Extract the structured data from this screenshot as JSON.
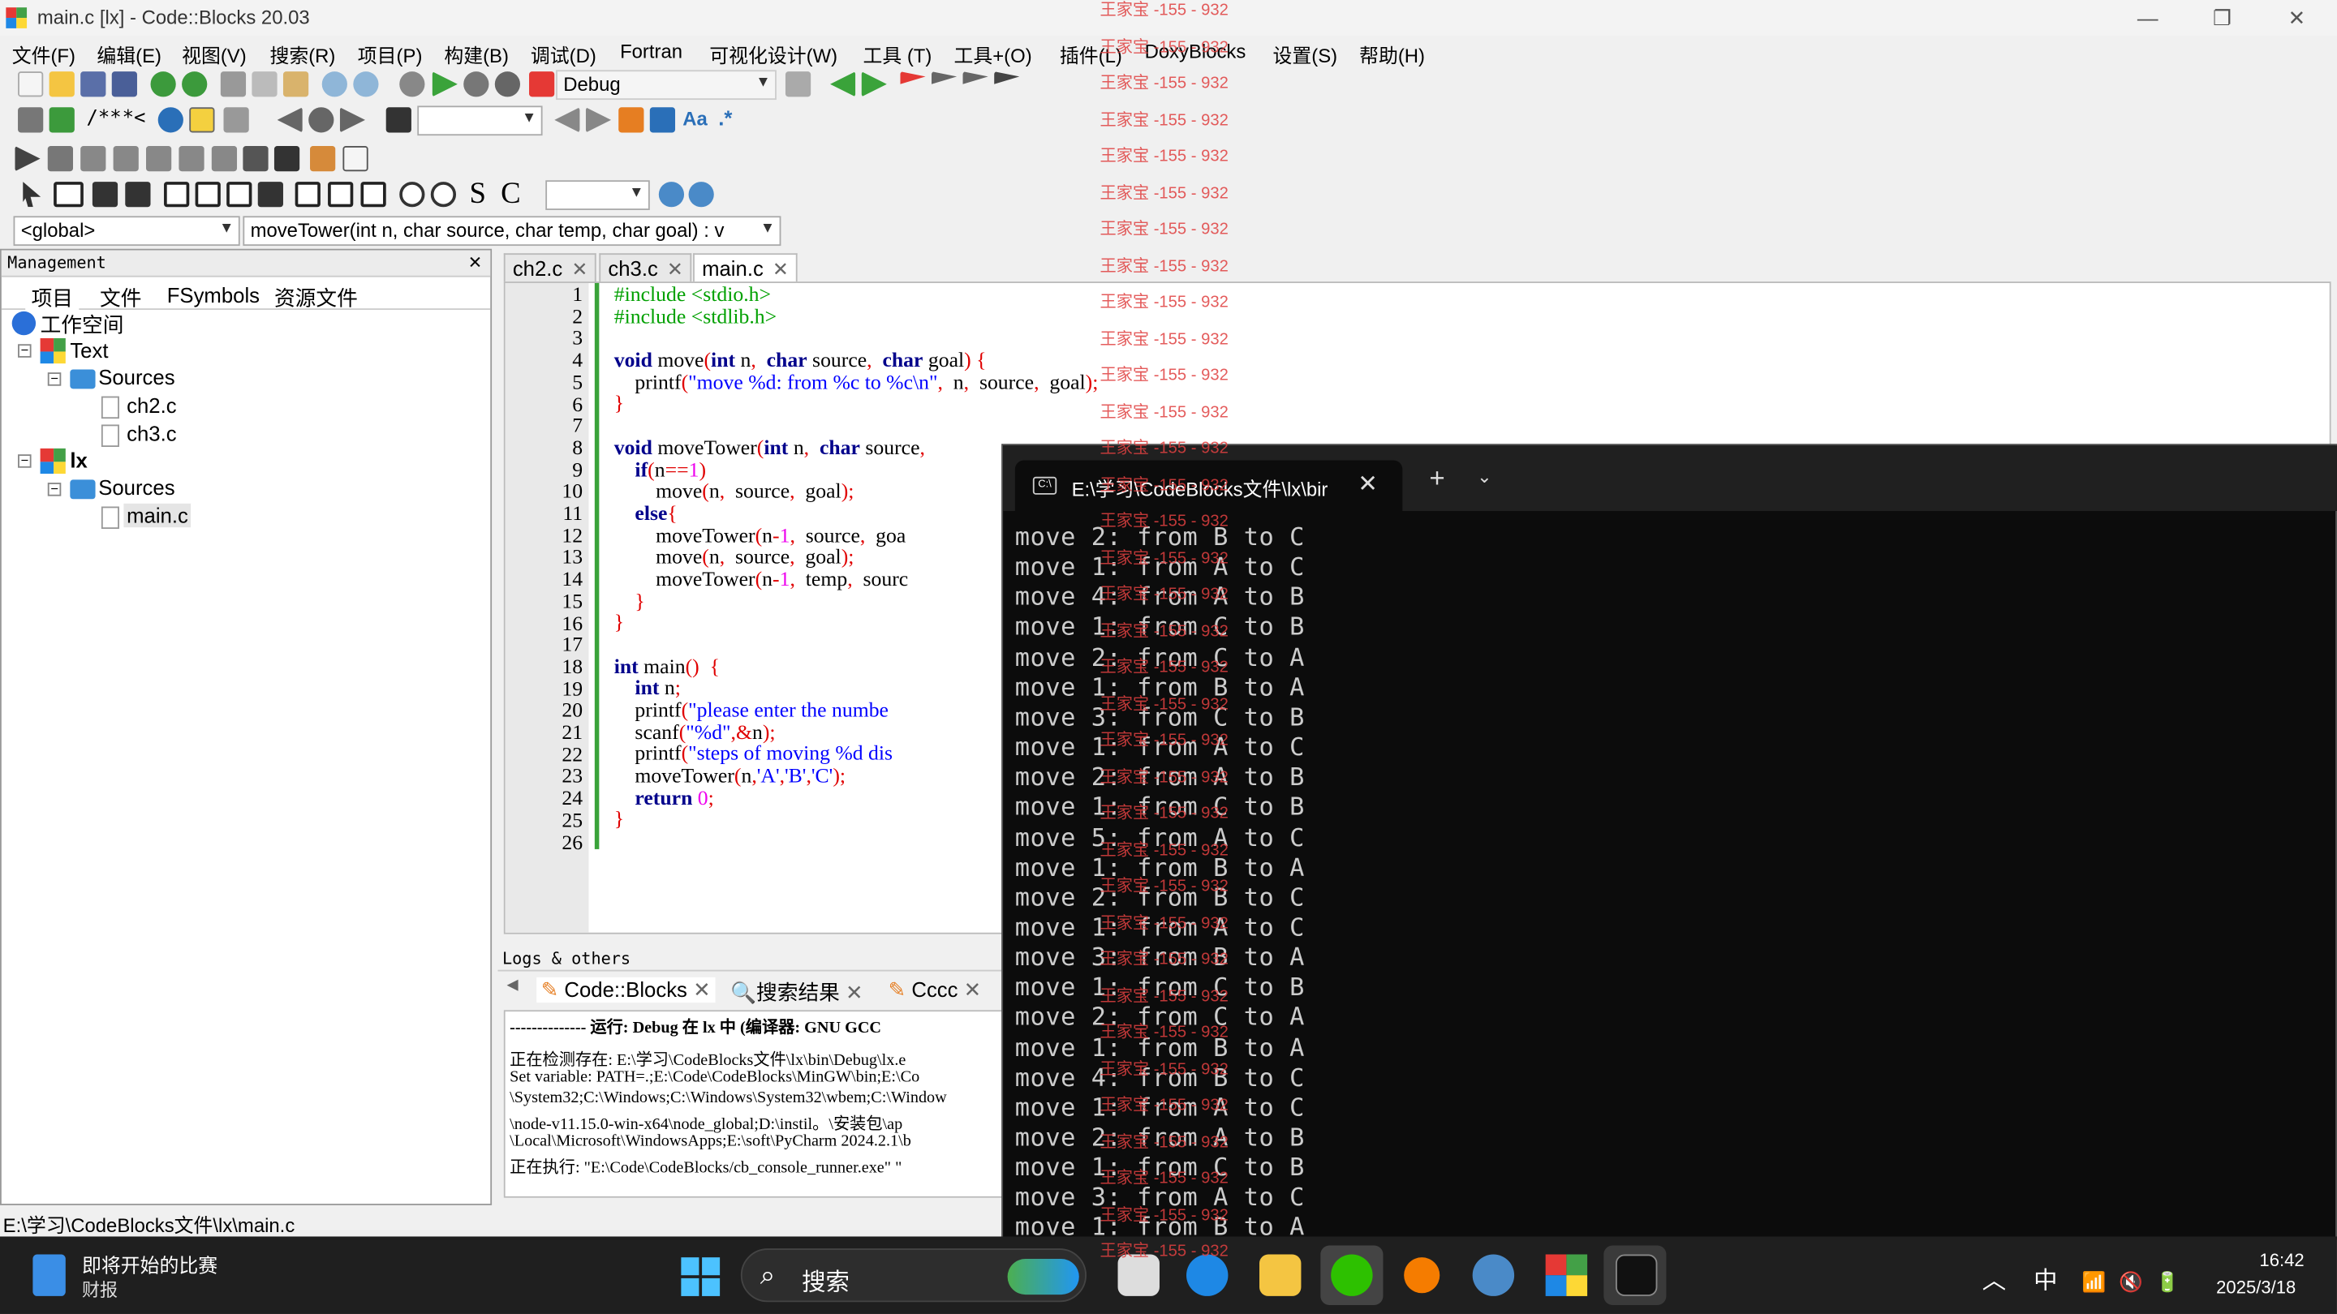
{
  "window": {
    "title": "main.c [lx] - Code::Blocks 20.03",
    "minimize": "—",
    "maximize": "❐",
    "close": "✕"
  },
  "menu": [
    "文件(F)",
    "编辑(E)",
    "视图(V)",
    "搜索(R)",
    "项目(P)",
    "构建(B)",
    "调试(D)",
    "Fortran",
    "可视化设计(W)",
    "工具 (T)",
    "工具+(O)",
    "插件(L)",
    "DoxyBlocks",
    "设置(S)",
    "帮助(H)"
  ],
  "toolbar": {
    "build_target": "Debug",
    "scope": "<global>",
    "function": "moveTower(int n, char source, char temp, char goal) : v",
    "comment_a": "/**",
    "comment_b": "*<",
    "text_s": "S",
    "text_c": "C",
    "aa": "Aa",
    "regex": ".*"
  },
  "management": {
    "title": "Management",
    "close": "✕",
    "tabs": [
      "项目",
      "文件",
      "FSymbols",
      "资源文件"
    ],
    "tree": {
      "workspace": "工作空间",
      "projects": [
        {
          "name": "Text",
          "sources_label": "Sources",
          "files": [
            "ch2.c",
            "ch3.c"
          ]
        },
        {
          "name": "lx",
          "sources_label": "Sources",
          "files": [
            "main.c"
          ]
        }
      ]
    }
  },
  "editor": {
    "tabs": [
      {
        "name": "ch2.c",
        "close": "✕"
      },
      {
        "name": "ch3.c",
        "close": "✕"
      },
      {
        "name": "main.c",
        "close": "✕"
      }
    ],
    "line_numbers": [
      "1",
      "2",
      "3",
      "4",
      "5",
      "6",
      "7",
      "8",
      "9",
      "10",
      "11",
      "12",
      "13",
      "14",
      "15",
      "16",
      "17",
      "18",
      "19",
      "20",
      "21",
      "22",
      "23",
      "24",
      "25",
      "26"
    ]
  },
  "logs": {
    "title": "Logs & others",
    "tabs": [
      "Code::Blocks",
      "搜索结果",
      "Cccc"
    ],
    "lines": [
      "-------------- 运行: Debug 在 lx 中 (编译器: GNU GCC",
      "正在检测存在:  E:\\学习\\CodeBlocks文件\\lx\\bin\\Debug\\lx.e",
      "Set variable: PATH=.;E:\\Code\\CodeBlocks\\MinGW\\bin;E:\\Co",
      "\\System32;C:\\Windows;C:\\Windows\\System32\\wbem;C:\\Window",
      "\\node-v11.15.0-win-x64\\node_global;D:\\instil。\\安装包\\ap",
      "\\Local\\Microsoft\\WindowsApps;E:\\soft\\PyCharm 2024.2.1\\b",
      "正在执行:  \"E:\\Code\\CodeBlocks/cb_console_runner.exe\" \""
    ]
  },
  "status": {
    "path": "E:\\学习\\CodeBlocks文件\\lx\\main.c"
  },
  "terminal": {
    "tab_title": "E:\\学习\\CodeBlocks文件\\lx\\bir",
    "tab_close": "✕",
    "plus": "+",
    "chevron": "⌄",
    "lines": [
      "move 2: from B to C",
      "move 1: from A to C",
      "move 4: from A to B",
      "move 1: from C to B",
      "move 2: from C to A",
      "move 1: from B to A",
      "move 3: from C to B",
      "move 1: from A to C",
      "move 2: from A to B",
      "move 1: from C to B",
      "move 5: from A to C",
      "move 1: from B to A",
      "move 2: from B to C",
      "move 1: from A to C",
      "move 3: from B to A",
      "move 1: from C to B",
      "move 2: from C to A",
      "move 1: from B to A",
      "move 4: from B to C",
      "move 1: from A to C",
      "move 2: from A to B",
      "move 1: from C to B",
      "move 3: from A to C",
      "move 1: from B to A"
    ]
  },
  "watermark": "王家宝 -155 - 932",
  "taskbar": {
    "news_title": "即将开始的比赛",
    "news_sub": "财报",
    "search_placeholder": "搜索",
    "search_glyph": "⌕",
    "tray_chevron": "︿",
    "ime": "中",
    "wifi": "📶",
    "volume": "🔇",
    "battery": "🔋",
    "time": "16:42",
    "date": "2025/3/18"
  },
  "colors": {
    "keyword": "#00008b",
    "preprocessor": "#00a000",
    "string": "#0000ff",
    "number": "#ee00ee",
    "operator": "#e00000",
    "watermark": "#e04040",
    "terminal_bg": "#0c0c0c"
  }
}
